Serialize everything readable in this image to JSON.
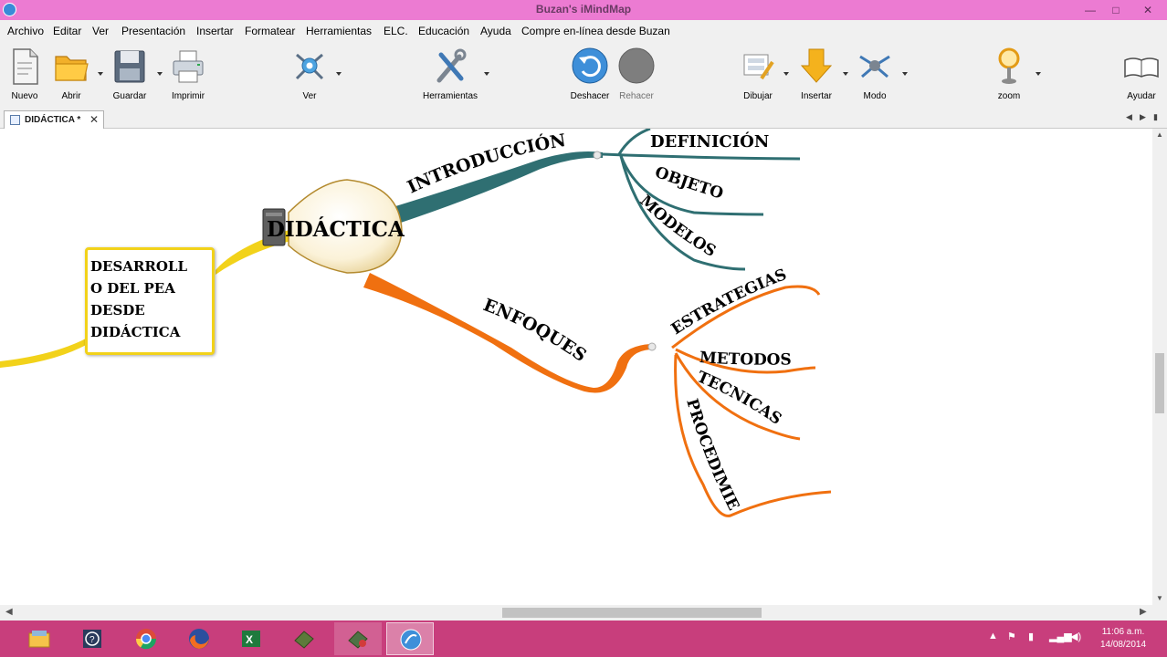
{
  "window": {
    "title": "Buzan's iMindMap",
    "minimize": "—",
    "maximize": "□",
    "close": "✕"
  },
  "menu": [
    "Archivo",
    "Editar",
    "Ver",
    "Presentación",
    "Insertar",
    "Formatear",
    "Herramientas",
    "ELC.",
    "Educación",
    "Ayuda",
    "Compre en-línea desde Buzan"
  ],
  "toolbar": {
    "nuevo": "Nuevo",
    "abrir": "Abrir",
    "guardar": "Guardar",
    "imprimir": "Imprimir",
    "ver": "Ver",
    "herramientas": "Herramientas",
    "deshacer": "Deshacer",
    "rehacer": "Rehacer",
    "dibujar": "Dibujar",
    "insertar": "Insertar",
    "modo": "Modo",
    "zoom": "zoom",
    "ayuda": "Ayudar"
  },
  "tabs": [
    {
      "label": "DIDÁCTICA *"
    }
  ],
  "mindmap": {
    "central": "DIDÁCTICA",
    "left_node": "DESARROLL\nO DEL PEA\nDESDE\nDIDÁCTICA",
    "branch_intro": {
      "label": "INTRODUCCIÓN",
      "color": "#2f6f72",
      "children": [
        "DEFINICIÓN",
        "OBJETO",
        "MODELOS"
      ]
    },
    "branch_enfoques": {
      "label": "ENFOQUES",
      "color": "#f07010",
      "children": [
        "ESTRATEGIAS",
        "METODOS",
        "TECNICAS",
        "PROCEDIMIENTOS"
      ]
    },
    "left_branch_color": "#f2d21a"
  },
  "taskbar": {
    "apps": [
      "file-explorer",
      "help",
      "chrome",
      "firefox",
      "excel",
      "imindmap-green",
      "imindmap-print",
      "imindmap"
    ],
    "clock_time": "11:06 a.m.",
    "clock_date": "14/08/2014"
  }
}
